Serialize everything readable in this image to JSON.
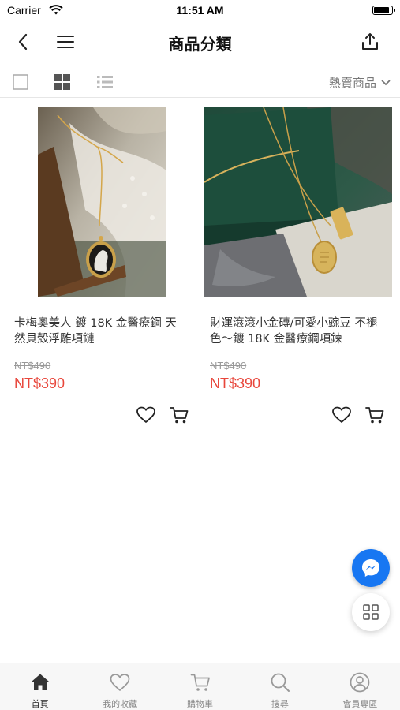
{
  "status_bar": {
    "carrier": "Carrier",
    "time": "11:51 AM",
    "battery_level": 0.9
  },
  "nav": {
    "title": "商品分類",
    "back_icon": "chevron-left-icon",
    "menu_icon": "hamburger-icon",
    "share_icon": "share-icon"
  },
  "toolbar": {
    "views": [
      "single-view-icon",
      "grid-view-icon",
      "list-view-icon"
    ],
    "active_view": "grid-view-icon",
    "sort_label": "熱賣商品"
  },
  "products": [
    {
      "name": "卡梅奧美人 鍍 18K 金醫療鋼 天然貝殼浮雕項鏈",
      "original_price": "NT$490",
      "price": "NT$390"
    },
    {
      "name": "財運滾滾小金磚/可愛小豌豆 不褪色～鍍 18K 金醫療鋼項鍊",
      "original_price": "NT$490",
      "price": "NT$390"
    }
  ],
  "colors": {
    "price": "#e8463b",
    "messenger": "#1877f2"
  },
  "tabs": [
    {
      "label": "首頁",
      "icon": "home-icon",
      "active": true
    },
    {
      "label": "我的收藏",
      "icon": "heart-icon",
      "active": false
    },
    {
      "label": "購物車",
      "icon": "cart-icon",
      "active": false
    },
    {
      "label": "搜尋",
      "icon": "search-icon",
      "active": false
    },
    {
      "label": "會員專區",
      "icon": "account-icon",
      "active": false
    }
  ]
}
